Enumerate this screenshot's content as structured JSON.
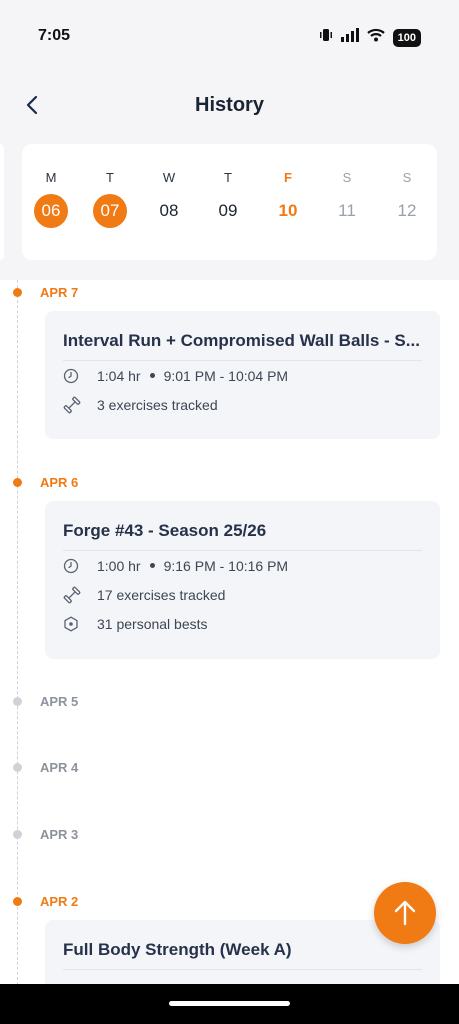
{
  "status_bar": {
    "time": "7:05",
    "battery": "100"
  },
  "header": {
    "title": "History"
  },
  "week": {
    "days": [
      {
        "letter": "M",
        "number": "06",
        "state": "done"
      },
      {
        "letter": "T",
        "number": "07",
        "state": "done"
      },
      {
        "letter": "W",
        "number": "08",
        "state": "normal"
      },
      {
        "letter": "T",
        "number": "09",
        "state": "normal"
      },
      {
        "letter": "F",
        "number": "10",
        "state": "today"
      },
      {
        "letter": "S",
        "number": "11",
        "state": "future"
      },
      {
        "letter": "S",
        "number": "12",
        "state": "future"
      }
    ]
  },
  "timeline": [
    {
      "date": "APR 7",
      "workout": {
        "title": "Interval Run + Compromised Wall Balls - S...",
        "duration": "1:04 hr",
        "time_range": "9:01 PM - 10:04 PM",
        "exercises": "3 exercises tracked"
      }
    },
    {
      "date": "APR 6",
      "workout": {
        "title": "Forge #43 - Season 25/26",
        "duration": "1:00 hr",
        "time_range": "9:16 PM - 10:16 PM",
        "exercises": "17 exercises tracked",
        "personal_bests": "31 personal bests"
      }
    },
    {
      "date": "APR 5"
    },
    {
      "date": "APR 4"
    },
    {
      "date": "APR 3"
    },
    {
      "date": "APR 2",
      "workout": {
        "title": "Full Body Strength (Week A)"
      }
    }
  ],
  "colors": {
    "accent": "#f07a14",
    "card_bg": "#f3f5f8",
    "header_bg": "#f5f5f7"
  },
  "icons": {
    "back": "chevron-left-icon",
    "duration": "clock-icon",
    "exercises": "dumbbell-icon",
    "personal_bests": "hexagon-star-icon",
    "fab": "arrow-up-icon"
  }
}
